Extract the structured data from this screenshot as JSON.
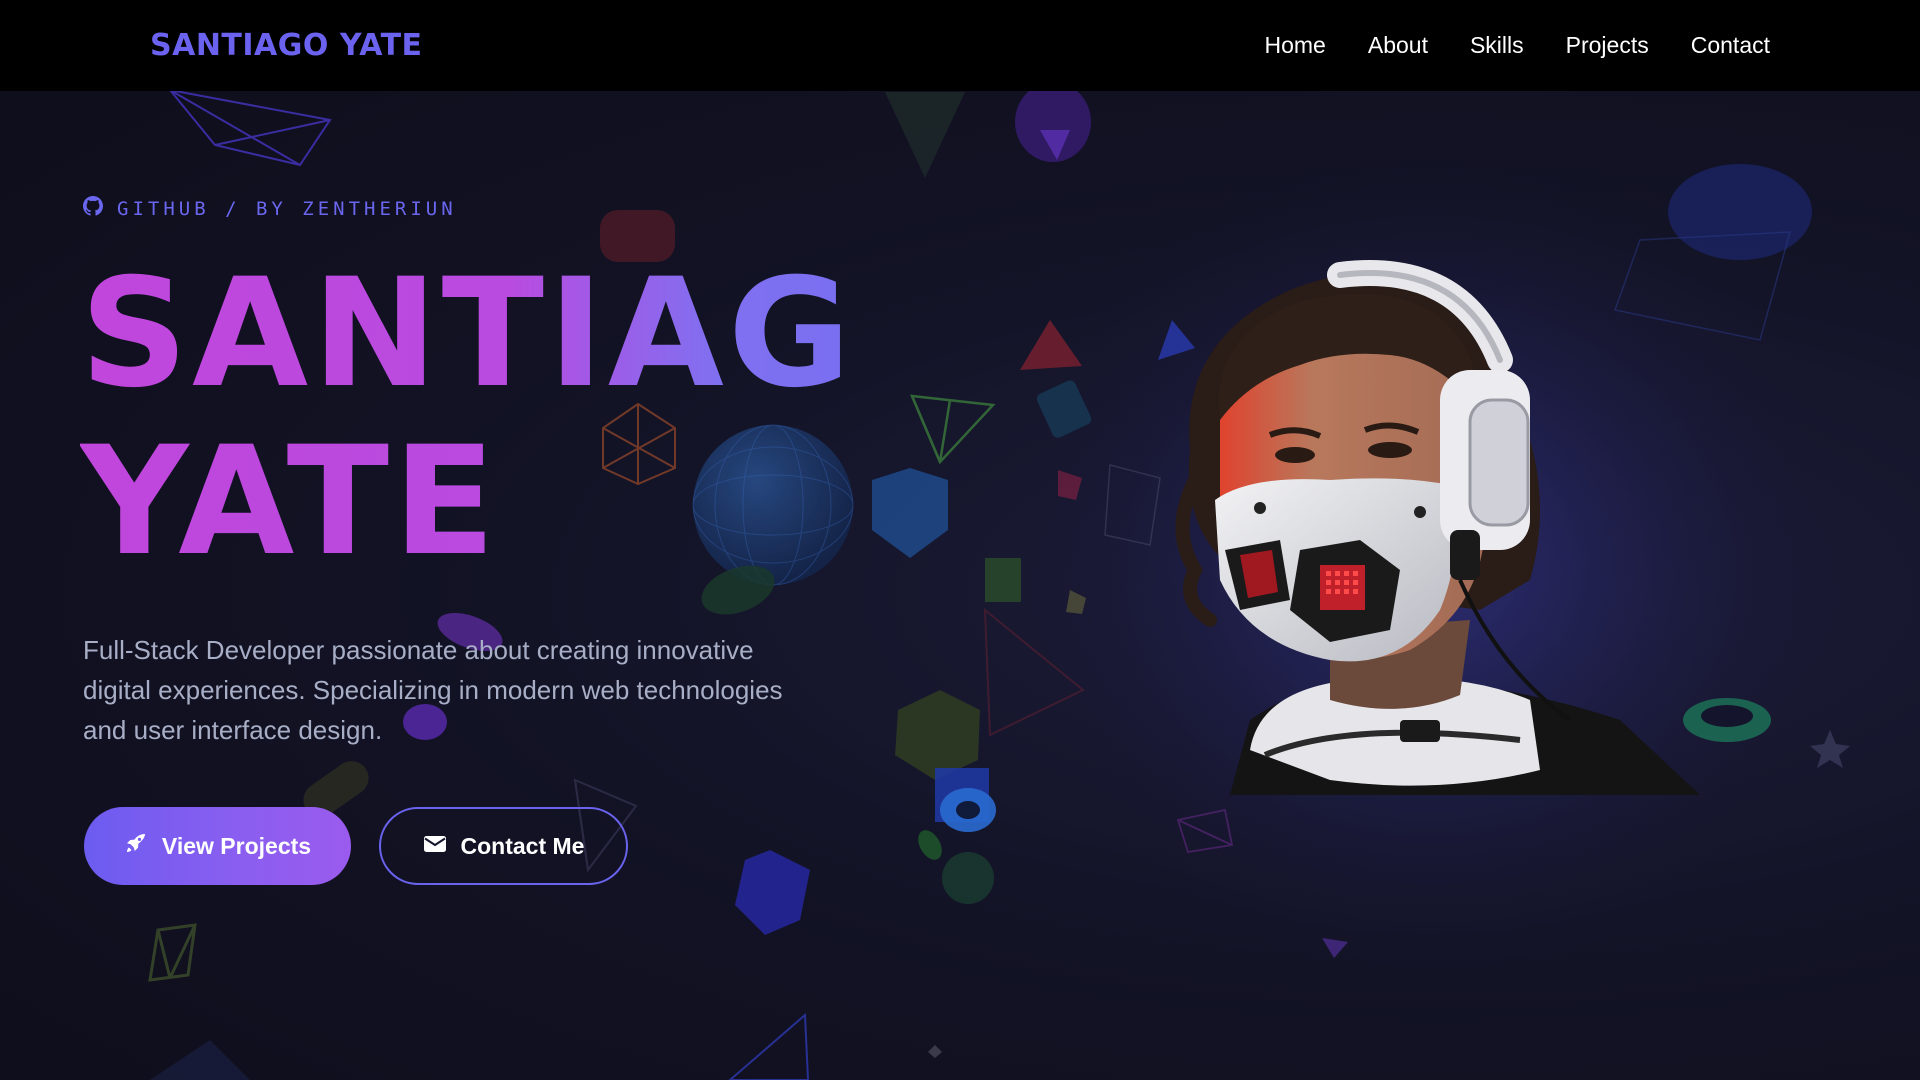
{
  "nav": {
    "logo": "SANTIAGO YATE",
    "links": [
      {
        "label": "Home"
      },
      {
        "label": "About"
      },
      {
        "label": "Skills"
      },
      {
        "label": "Projects"
      },
      {
        "label": "Contact"
      }
    ]
  },
  "hero": {
    "eyebrow": "GITHUB / BY ZENTHERIUN",
    "eyebrow_icon": "github-icon",
    "title_line1": "SANTIAGO",
    "title_line2": "YATE",
    "description": "Full-Stack Developer passionate about creating innovative digital experiences. Specializing in modern web technologies and user interface design.",
    "primary_button": {
      "label": "View Projects",
      "icon": "rocket-icon"
    },
    "secondary_button": {
      "label": "Contact Me",
      "icon": "envelope-icon"
    }
  },
  "colors": {
    "accent": "#6c5cf0",
    "gradient_start": "#c046dc",
    "gradient_end": "#7a6ff1",
    "background": "#0f0f1c",
    "nav_bg": "#000000"
  }
}
